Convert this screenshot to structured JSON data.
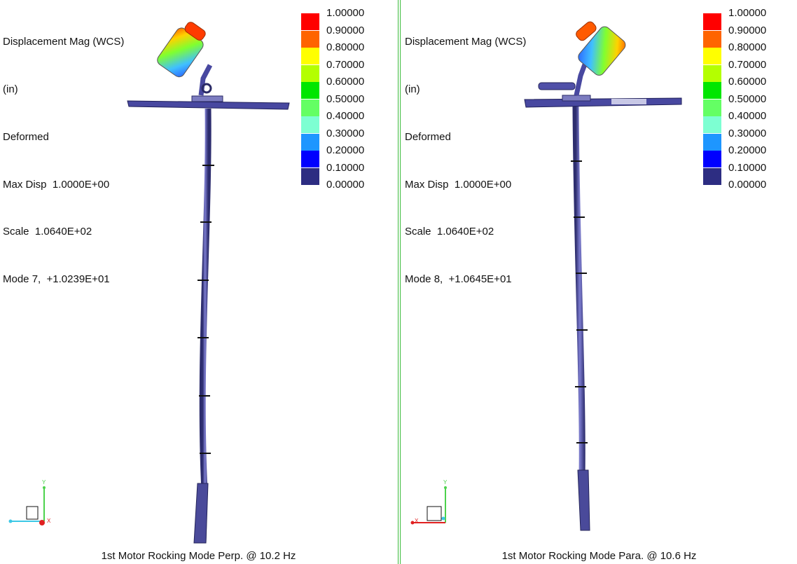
{
  "legend": {
    "values": [
      "1.00000",
      "0.90000",
      "0.80000",
      "0.70000",
      "0.60000",
      "0.50000",
      "0.40000",
      "0.30000",
      "0.20000",
      "0.10000",
      "0.00000"
    ],
    "colors": [
      "#ff0000",
      "#ff6400",
      "#ffff00",
      "#b4ff00",
      "#00e600",
      "#64ff64",
      "#7dffd2",
      "#1e96ff",
      "#0000ff",
      "#2d2d82"
    ]
  },
  "left": {
    "title": "Displacement Mag (WCS)",
    "units": "(in)",
    "state": "Deformed",
    "max_disp": "Max Disp  1.0000E+00",
    "scale": "Scale  1.0640E+02",
    "mode": "Mode 7,  +1.0239E+01",
    "caption": "1st Motor Rocking Mode Perp. @ 10.2 Hz"
  },
  "right": {
    "title": "Displacement Mag (WCS)",
    "units": "(in)",
    "state": "Deformed",
    "max_disp": "Max Disp  1.0000E+00",
    "scale": "Scale  1.0640E+02",
    "mode": "Mode 8,  +1.0645E+01",
    "caption": "1st Motor Rocking Mode Para. @ 10.6 Hz"
  },
  "triad": {
    "y_label": "Y",
    "x_label": "X",
    "z_label": "Z"
  }
}
